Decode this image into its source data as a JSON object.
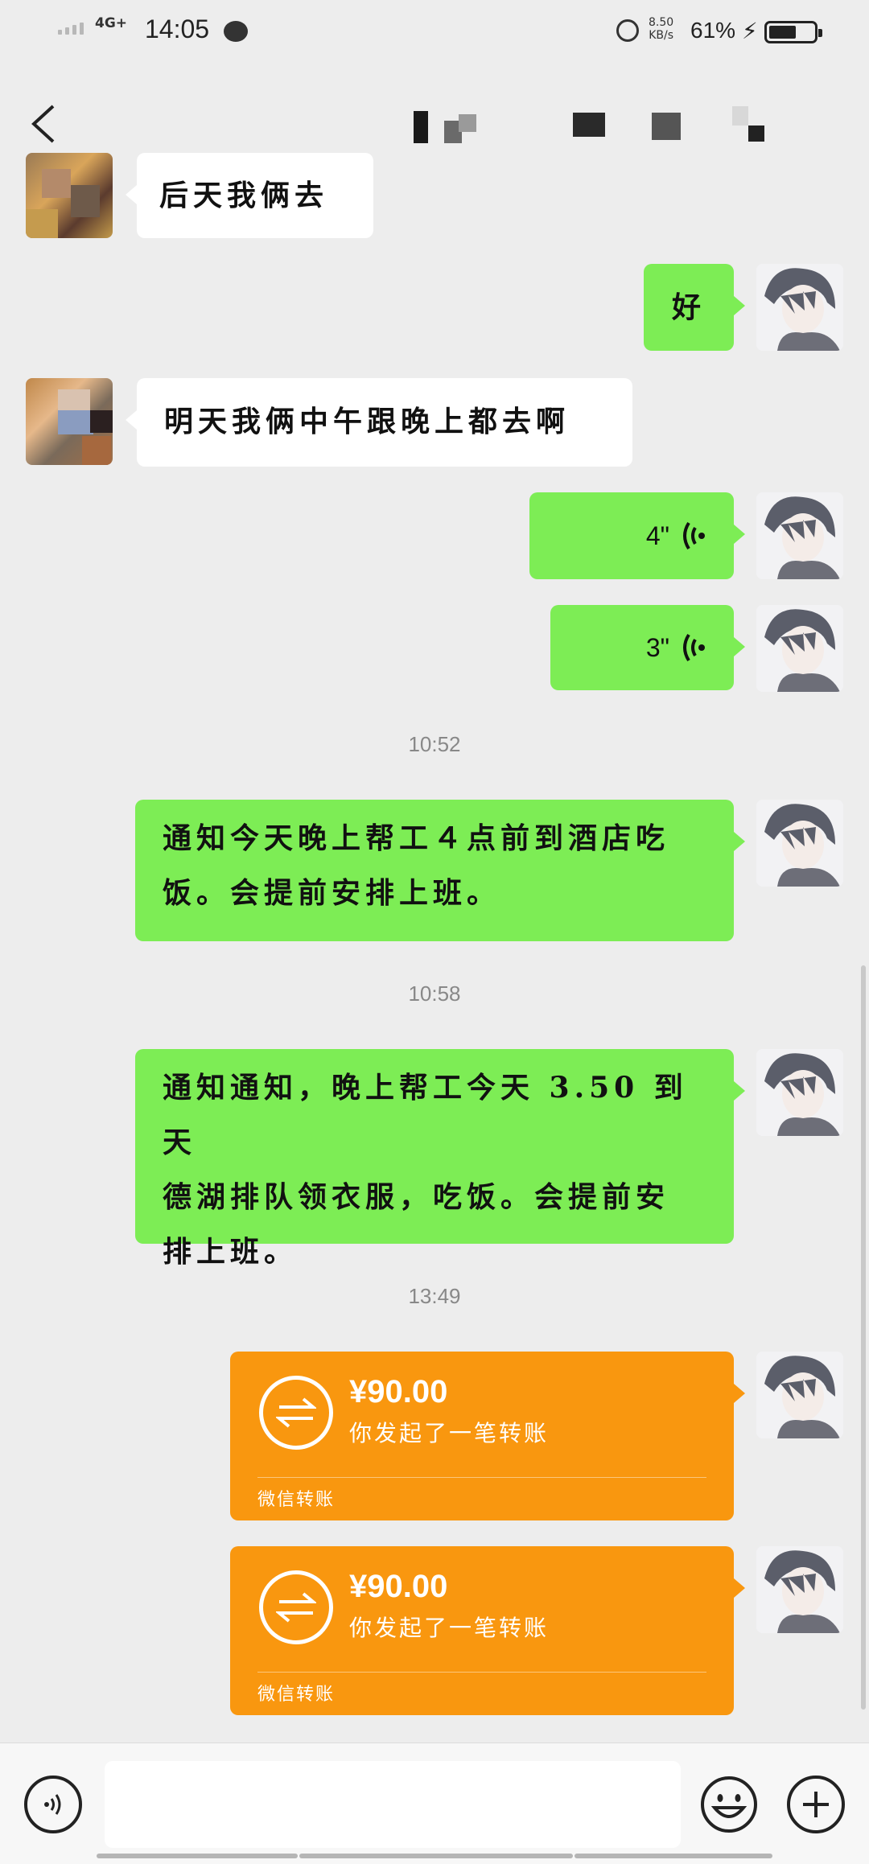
{
  "status_bar": {
    "network": "4G+",
    "time": "14:05",
    "speed_value": "8.50",
    "speed_unit": "KB/s",
    "battery_percent": "61%",
    "battery_level": 0.61
  },
  "header": {
    "back_icon": "chevron-left-icon",
    "title_obscured": true
  },
  "messages": [
    {
      "side": "them",
      "type": "text",
      "text": "后天我俩去"
    },
    {
      "side": "me",
      "type": "text",
      "text": "好"
    },
    {
      "side": "them",
      "type": "text",
      "text": "明天我俩中午跟晚上都去啊"
    },
    {
      "side": "me",
      "type": "voice",
      "duration": "4\""
    },
    {
      "side": "me",
      "type": "voice",
      "duration": "3\""
    },
    {
      "type": "time",
      "text": "10:52"
    },
    {
      "side": "me",
      "type": "text",
      "line1": "通知今天晚上帮工４点前到酒店吃",
      "line2": "饭。会提前安排上班。"
    },
    {
      "type": "time",
      "text": "10:58"
    },
    {
      "side": "me",
      "type": "text",
      "line1": "通知通知，晚上帮工今天 3.50 到天",
      "line2": "德湖排队领衣服，吃饭。会提前安",
      "line3": "排上班。"
    },
    {
      "type": "time",
      "text": "13:49"
    },
    {
      "side": "me",
      "type": "transfer",
      "amount": "¥90.00",
      "desc": "你发起了一笔转账",
      "footer": "微信转账"
    },
    {
      "side": "me",
      "type": "transfer",
      "amount": "¥90.00",
      "desc": "你发起了一笔转账",
      "footer": "微信转账"
    }
  ],
  "input_bar": {
    "voice_icon": "voice-input-icon",
    "placeholder": "",
    "emoji_icon": "emoji-icon",
    "plus_icon": "plus-icon"
  },
  "colors": {
    "background": "#ededed",
    "my_bubble": "#7ded55",
    "their_bubble": "#ffffff",
    "transfer_card": "#f9970f"
  }
}
